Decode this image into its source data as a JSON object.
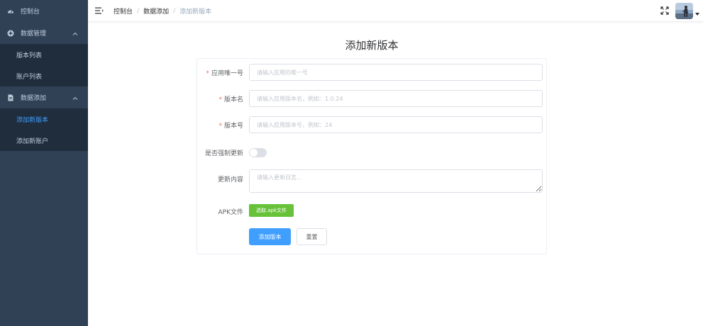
{
  "sidebar": {
    "dashboard": {
      "label": "控制台",
      "icon": "dashboard-icon"
    },
    "data_manage": {
      "label": "数据管理",
      "icon": "plus-circle-icon",
      "items": [
        {
          "label": "版本列表"
        },
        {
          "label": "账户列表"
        }
      ]
    },
    "data_add": {
      "label": "数据添加",
      "icon": "document-icon",
      "items": [
        {
          "label": "添加新版本",
          "active": true
        },
        {
          "label": "添加新账户"
        }
      ]
    },
    "colors": {
      "background": "#304156",
      "submenu": "#1f2d3d",
      "active": "#409eff"
    }
  },
  "header": {
    "breadcrumb": [
      "控制台",
      "数据添加",
      "添加新版本"
    ],
    "separator": "/"
  },
  "page": {
    "title": "添加新版本"
  },
  "form": {
    "app_id": {
      "label": "应用唯一号",
      "required": true,
      "placeholder": "请输入应用的唯一号",
      "value": ""
    },
    "version_name": {
      "label": "版本名",
      "required": true,
      "placeholder": "请输入应用版本名，例如：1.0.24",
      "value": ""
    },
    "version_code": {
      "label": "版本号",
      "required": true,
      "placeholder": "请输入应用版本号，例如：24",
      "value": ""
    },
    "force_update": {
      "label": "是否强制更新",
      "value": false
    },
    "changelog": {
      "label": "更新内容",
      "placeholder": "请输入更新日志...",
      "value": ""
    },
    "apk": {
      "label": "APK文件",
      "button": "选取.apk文件"
    },
    "submit_label": "添加版本",
    "reset_label": "重置"
  }
}
